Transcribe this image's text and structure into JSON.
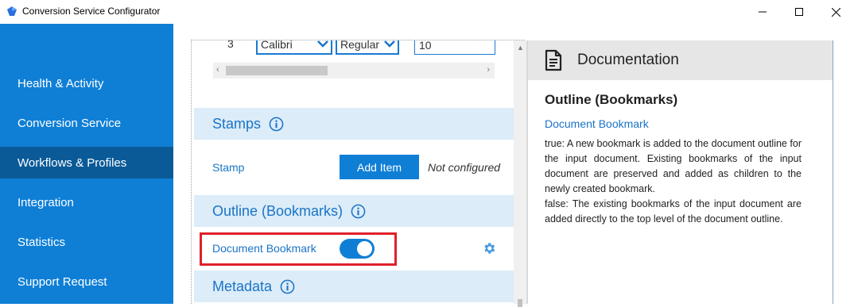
{
  "window": {
    "title": "Conversion Service Configurator",
    "controls": {
      "minimize": "—",
      "maximize": "☐",
      "close": "✕"
    }
  },
  "sidebar": {
    "items": [
      {
        "label": "Health & Activity",
        "active": false
      },
      {
        "label": "Conversion Service",
        "active": false
      },
      {
        "label": "Workflows & Profiles",
        "active": true
      },
      {
        "label": "Integration",
        "active": false
      },
      {
        "label": "Statistics",
        "active": false
      },
      {
        "label": "Support Request",
        "active": false
      }
    ]
  },
  "form": {
    "font_row": {
      "number": "3",
      "font": "Calibri",
      "style": "Regular",
      "size": "10"
    },
    "sections": {
      "stamps": {
        "title": "Stamps",
        "field_label": "Stamp",
        "add_button": "Add Item",
        "status": "Not configured"
      },
      "outline": {
        "title": "Outline (Bookmarks)",
        "field_label": "Document Bookmark",
        "toggle_on": true
      },
      "metadata": {
        "title": "Metadata"
      }
    }
  },
  "documentation": {
    "header": "Documentation",
    "heading": "Outline (Bookmarks)",
    "link": "Document Bookmark",
    "paragraph_true": "true: A new bookmark is added to the document outline for the input document. Existing bookmarks of the input document are preserved and added as children to the newly created bookmark.",
    "paragraph_false": "false: The existing bookmarks of the input document are added directly to the top level of the document outline."
  },
  "colors": {
    "accent": "#0f7fd6",
    "sidebar_active": "#0b5a98",
    "section_bg": "#dcecf8",
    "highlight": "#e0202a"
  }
}
